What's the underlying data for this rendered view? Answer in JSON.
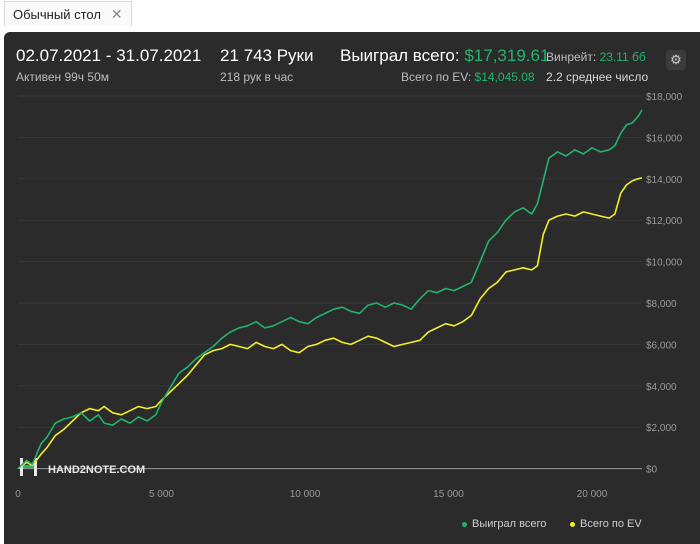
{
  "tab": {
    "label": "Обычный стол",
    "close_glyph": "✕"
  },
  "header": {
    "date_range": "02.07.2021 - 31.07.2021",
    "active": "Активен 99ч 50м",
    "hands": "21 743 Руки",
    "hands_per_hour": "218 рук в час",
    "won_label": "Выиграл всего:",
    "won_value": "$17,319.61",
    "ev_label": "Всего по EV:",
    "ev_value": "$14,045.08",
    "winrate_label": "Винрейт:",
    "winrate_value": "23.11 бб",
    "avg_text": "2.2 среднее число"
  },
  "watermark": "HAND2NOTE.COM",
  "colors": {
    "won": "#20b46e",
    "ev": "#f2ee2a",
    "bg": "#2b2b2b",
    "grid": "#383838"
  },
  "chart_data": {
    "type": "line",
    "xlim": [
      0,
      21743
    ],
    "ylim": [
      -500,
      18000
    ],
    "x_ticks": [
      {
        "v": 0,
        "label": "0"
      },
      {
        "v": 5000,
        "label": "5 000"
      },
      {
        "v": 10000,
        "label": "10 000"
      },
      {
        "v": 15000,
        "label": "15 000"
      },
      {
        "v": 20000,
        "label": "20 000"
      }
    ],
    "y_ticks": [
      {
        "v": 0,
        "label": "$0"
      },
      {
        "v": 2000,
        "label": "$2,000"
      },
      {
        "v": 4000,
        "label": "$4,000"
      },
      {
        "v": 6000,
        "label": "$6,000"
      },
      {
        "v": 8000,
        "label": "$8,000"
      },
      {
        "v": 10000,
        "label": "$10,000"
      },
      {
        "v": 12000,
        "label": "$12,000"
      },
      {
        "v": 14000,
        "label": "$14,000"
      },
      {
        "v": 16000,
        "label": "$16,000"
      },
      {
        "v": 18000,
        "label": "$18,000"
      }
    ],
    "series": [
      {
        "name": "Выиграл всего",
        "color": "#20b46e",
        "x": [
          0,
          300,
          500,
          800,
          1000,
          1300,
          1600,
          1900,
          2200,
          2500,
          2800,
          3000,
          3300,
          3600,
          3900,
          4200,
          4500,
          4800,
          5000,
          5300,
          5600,
          5900,
          6200,
          6500,
          6800,
          7100,
          7400,
          7700,
          8000,
          8300,
          8600,
          8900,
          9200,
          9500,
          9800,
          10100,
          10400,
          10700,
          11000,
          11300,
          11600,
          11900,
          12200,
          12500,
          12800,
          13100,
          13400,
          13700,
          14000,
          14300,
          14600,
          14900,
          15200,
          15500,
          15800,
          16100,
          16400,
          16700,
          17000,
          17300,
          17600,
          17900,
          18100,
          18300,
          18500,
          18800,
          19100,
          19400,
          19700,
          20000,
          20300,
          20600,
          20800,
          21000,
          21200,
          21400,
          21600,
          21743
        ],
        "y": [
          0,
          400,
          200,
          1200,
          1500,
          2200,
          2400,
          2500,
          2700,
          2300,
          2600,
          2200,
          2100,
          2400,
          2200,
          2500,
          2300,
          2600,
          3200,
          3900,
          4600,
          4900,
          5300,
          5600,
          5900,
          6300,
          6600,
          6800,
          6900,
          7100,
          6800,
          6900,
          7100,
          7300,
          7100,
          7000,
          7300,
          7500,
          7700,
          7800,
          7600,
          7500,
          7900,
          8000,
          7800,
          8000,
          7900,
          7700,
          8200,
          8600,
          8500,
          8700,
          8600,
          8800,
          9000,
          10000,
          11000,
          11400,
          12000,
          12400,
          12600,
          12300,
          12800,
          13900,
          15000,
          15300,
          15100,
          15400,
          15200,
          15500,
          15300,
          15400,
          15600,
          16200,
          16600,
          16700,
          17000,
          17319
        ]
      },
      {
        "name": "Всего по EV",
        "color": "#f2ee2a",
        "x": [
          0,
          300,
          500,
          800,
          1000,
          1300,
          1600,
          1900,
          2200,
          2500,
          2800,
          3000,
          3300,
          3600,
          3900,
          4200,
          4500,
          4800,
          5000,
          5300,
          5600,
          5900,
          6200,
          6500,
          6800,
          7100,
          7400,
          7700,
          8000,
          8300,
          8600,
          8900,
          9200,
          9500,
          9800,
          10100,
          10400,
          10700,
          11000,
          11300,
          11600,
          11900,
          12200,
          12500,
          12800,
          13100,
          13400,
          13700,
          14000,
          14300,
          14600,
          14900,
          15200,
          15500,
          15800,
          16100,
          16400,
          16700,
          17000,
          17300,
          17600,
          17900,
          18100,
          18300,
          18500,
          18800,
          19100,
          19400,
          19700,
          20000,
          20300,
          20600,
          20800,
          21000,
          21200,
          21400,
          21600,
          21743
        ],
        "y": [
          0,
          300,
          150,
          700,
          1000,
          1600,
          1900,
          2300,
          2700,
          2900,
          2800,
          3000,
          2700,
          2600,
          2800,
          3000,
          2900,
          3000,
          3300,
          3700,
          4100,
          4500,
          5000,
          5500,
          5700,
          5800,
          6000,
          5900,
          5800,
          6100,
          5900,
          5800,
          6000,
          5700,
          5600,
          5900,
          6000,
          6200,
          6300,
          6100,
          6000,
          6200,
          6400,
          6300,
          6100,
          5900,
          6000,
          6100,
          6200,
          6600,
          6800,
          7000,
          6900,
          7100,
          7400,
          8200,
          8700,
          9000,
          9500,
          9600,
          9700,
          9600,
          9800,
          11300,
          12000,
          12200,
          12300,
          12200,
          12400,
          12300,
          12200,
          12100,
          12300,
          13300,
          13700,
          13900,
          14000,
          14045
        ]
      }
    ]
  }
}
